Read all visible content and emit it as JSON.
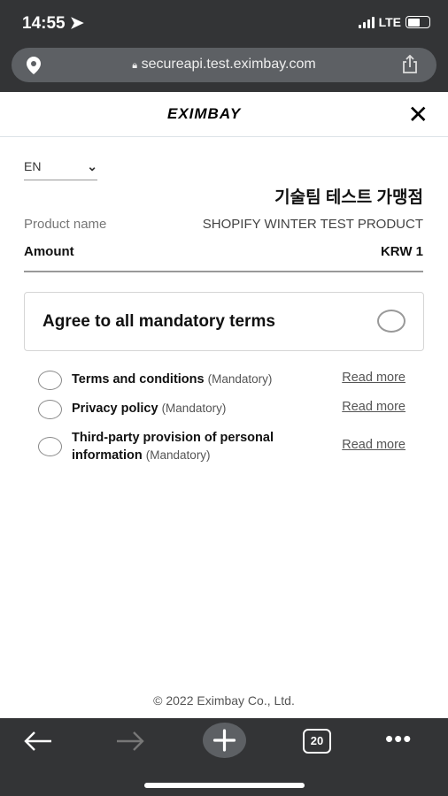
{
  "status_bar": {
    "time": "14:55",
    "network": "LTE",
    "battery_level": 0.6
  },
  "browser": {
    "url": "secureapi.test.eximbay.com",
    "tab_count": "20"
  },
  "header": {
    "logo": "EXIMBAY"
  },
  "language": {
    "selected": "EN"
  },
  "merchant_name": "기술팀 테스트 가맹점",
  "order": {
    "product_label": "Product name",
    "product_value": "SHOPIFY WINTER TEST PRODUCT",
    "amount_label": "Amount",
    "amount_value": "KRW 1"
  },
  "agree_all": "Agree to all mandatory terms",
  "terms": [
    {
      "label": "Terms and conditions",
      "tag": "(Mandatory)",
      "link": "Read more"
    },
    {
      "label": "Privacy policy",
      "tag": "(Mandatory)",
      "link": "Read more"
    },
    {
      "label": "Third-party provision of personal information",
      "tag": "(Mandatory)",
      "link": "Read more"
    }
  ],
  "footer": "© 2022 Eximbay Co., Ltd."
}
